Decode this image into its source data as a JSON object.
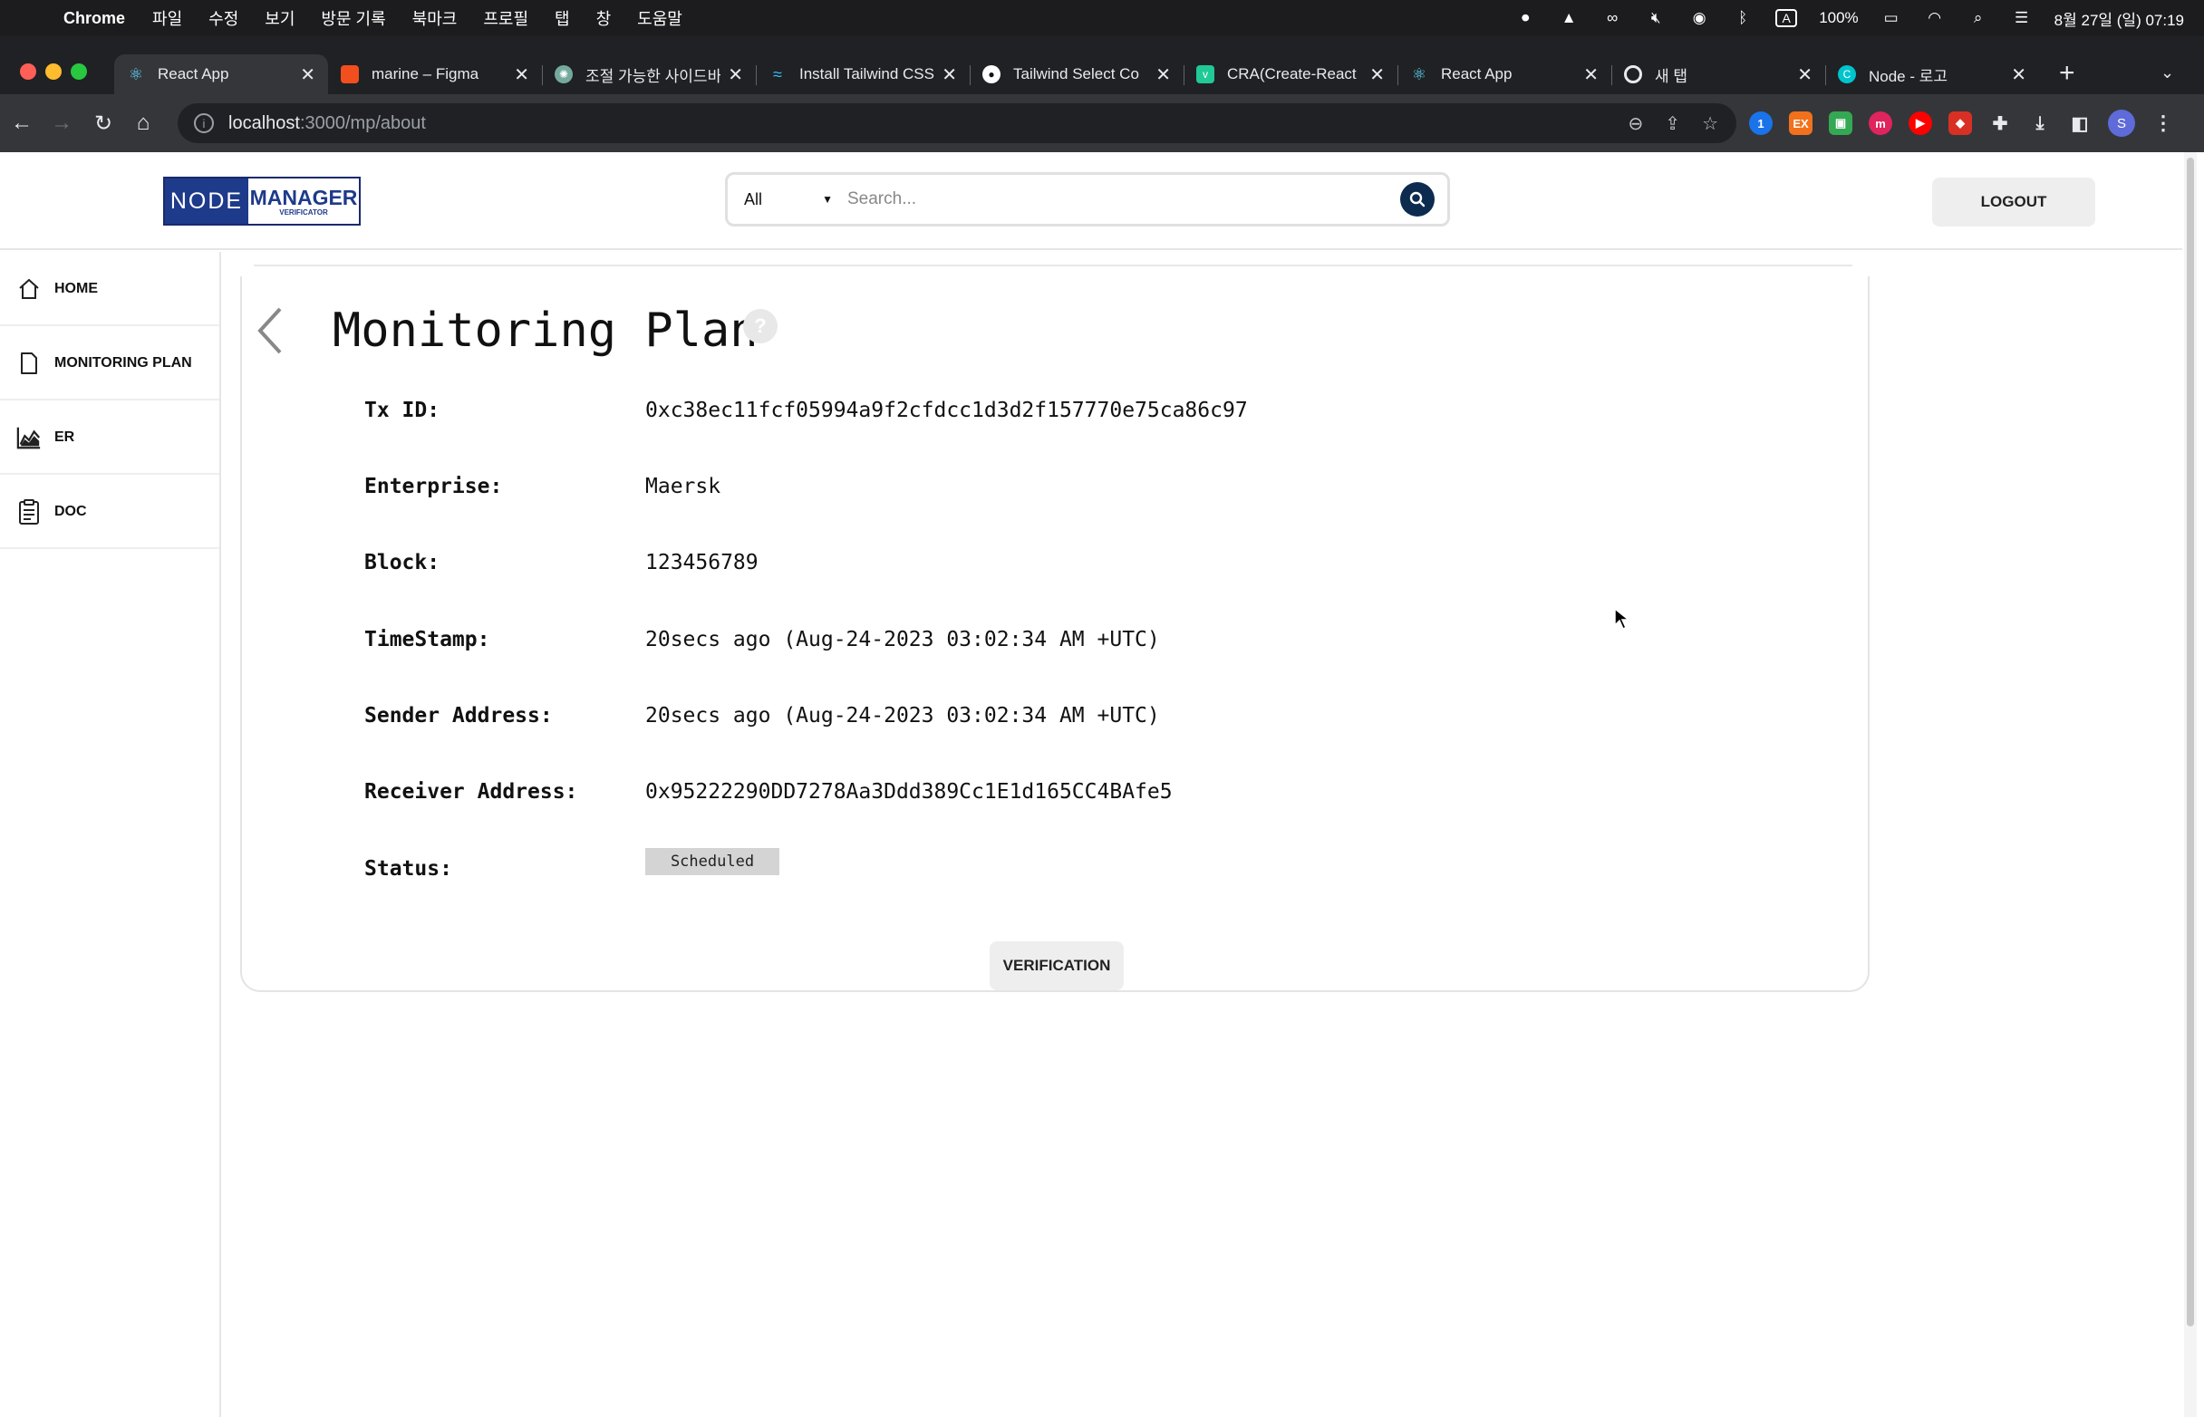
{
  "menubar": {
    "app_name": "Chrome",
    "items": [
      "파일",
      "수정",
      "보기",
      "방문 기록",
      "북마크",
      "프로필",
      "탭",
      "창",
      "도움말"
    ],
    "battery": "100%",
    "datetime": "8월 27일 (일) 07:19"
  },
  "tabs": [
    {
      "title": "React App",
      "favicon": "react-icon",
      "color": "#61dafb"
    },
    {
      "title": "marine – Figma",
      "favicon": "figma-icon",
      "color": "#f24e1e"
    },
    {
      "title": "조절 가능한 사이드바",
      "favicon": "chatgpt-icon",
      "color": "#74aa9c"
    },
    {
      "title": "Install Tailwind CSS",
      "favicon": "tailwind-icon",
      "color": "#38bdf8"
    },
    {
      "title": "Tailwind Select Co",
      "favicon": "github-icon",
      "color": "#ffffff"
    },
    {
      "title": "CRA(Create-React",
      "favicon": "velog-icon",
      "color": "#20c997"
    },
    {
      "title": "React App",
      "favicon": "react-icon",
      "color": "#61dafb"
    },
    {
      "title": "새 탭",
      "favicon": "chrome-icon",
      "color": "#e8eaed"
    },
    {
      "title": "Node - 로고",
      "favicon": "canva-icon",
      "color": "#00c4cc"
    }
  ],
  "address": {
    "host": "localhost",
    "path": ":3000/mp/about"
  },
  "header": {
    "logo_left": "NODE",
    "logo_right": "MANAGER",
    "logo_sub": "VERIFICATOR",
    "search_category": "All",
    "search_placeholder": "Search...",
    "logout_label": "LOGOUT"
  },
  "sidebar": {
    "items": [
      {
        "label": "HOME",
        "icon": "home-icon"
      },
      {
        "label": "MONITORING PLAN",
        "icon": "document-icon"
      },
      {
        "label": "ER",
        "icon": "chart-icon"
      },
      {
        "label": "DOC",
        "icon": "clipboard-icon"
      }
    ]
  },
  "main": {
    "title": "Monitoring Plan",
    "help_symbol": "?",
    "fields": [
      {
        "label": "Tx ID:",
        "value": "0xc38ec11fcf05994a9f2cfdcc1d3d2f157770e75ca86c97"
      },
      {
        "label": "Enterprise:",
        "value": "Maersk"
      },
      {
        "label": "Block:",
        "value": "123456789"
      },
      {
        "label": "TimeStamp:",
        "value": "20secs ago (Aug-24-2023 03:02:34 AM +UTC)"
      },
      {
        "label": "Sender Address:",
        "value": "20secs ago (Aug-24-2023 03:02:34 AM +UTC)"
      },
      {
        "label": "Receiver Address:",
        "value": "0x95222290DD7278Aa3Ddd389Cc1E1d165CC4BAfe5"
      }
    ],
    "status_label": "Status:",
    "status_value": "Scheduled",
    "verify_label": "VERIFICATION"
  }
}
